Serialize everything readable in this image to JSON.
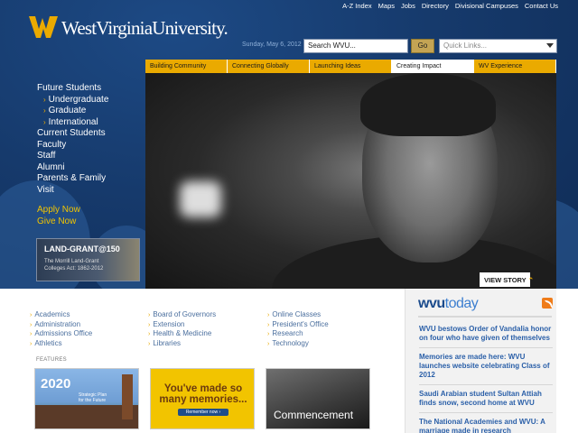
{
  "logo": {
    "text": "WestVirginiaUniversity.",
    "icon": "wv-flying-logo"
  },
  "utility_links": [
    "A-Z Index",
    "Maps",
    "Jobs",
    "Directory",
    "Divisional Campuses",
    "Contact Us"
  ],
  "search": {
    "date": "Sunday, May 6, 2012",
    "value": "Search WVU...",
    "go_label": "Go",
    "quick_links": "Quick Links..."
  },
  "tabs": [
    {
      "label": "Building Community",
      "active": false
    },
    {
      "label": "Connecting Globally",
      "active": false
    },
    {
      "label": "Launching Ideas",
      "active": false
    },
    {
      "label": "Creating Impact",
      "active": true
    },
    {
      "label": "WV Experience",
      "active": false
    }
  ],
  "leftnav": {
    "future_students": "Future Students",
    "sub": [
      "Undergraduate",
      "Graduate",
      "International"
    ],
    "items": [
      "Current Students",
      "Faculty",
      "Staff",
      "Alumni",
      "Parents & Family",
      "Visit"
    ],
    "apply": "Apply Now",
    "give": "Give Now"
  },
  "landgrant": {
    "title": "LAND-GRANT@150",
    "line1": "The Morrill Land-Grant",
    "line2": "Colleges Act: 1862-2012"
  },
  "hero": {
    "view_story": "VIEW STORY"
  },
  "links": {
    "col1": [
      "Academics",
      "Administration",
      "Admissions Office",
      "Athletics"
    ],
    "col2": [
      "Board of Governors",
      "Extension",
      "Health & Medicine",
      "Libraries"
    ],
    "col3": [
      "Online Classes",
      "President's Office",
      "Research",
      "Technology"
    ]
  },
  "features": {
    "label": "FEATURES",
    "f1": {
      "title": "2020",
      "sub1": "Strategic Plan",
      "sub2": "for the Future"
    },
    "f2": {
      "title": "You've made so many memories...",
      "button": "Remember now ›"
    },
    "f3": {
      "title": "Commencement"
    }
  },
  "today": {
    "logo_w": "wvu",
    "logo_t": "today",
    "news": [
      "WVU bestows Order of Vandalia honor on four who have given of themselves",
      "Memories are made here: WVU launches website celebrating Class of 2012",
      "Saudi Arabian student Sultan Attiah finds snow, second home at WVU",
      "The National Academies and WVU: A marriage made in research"
    ]
  },
  "colors": {
    "navy": "#163a6c",
    "gold": "#eaaa00",
    "link": "#4b6f9e"
  }
}
